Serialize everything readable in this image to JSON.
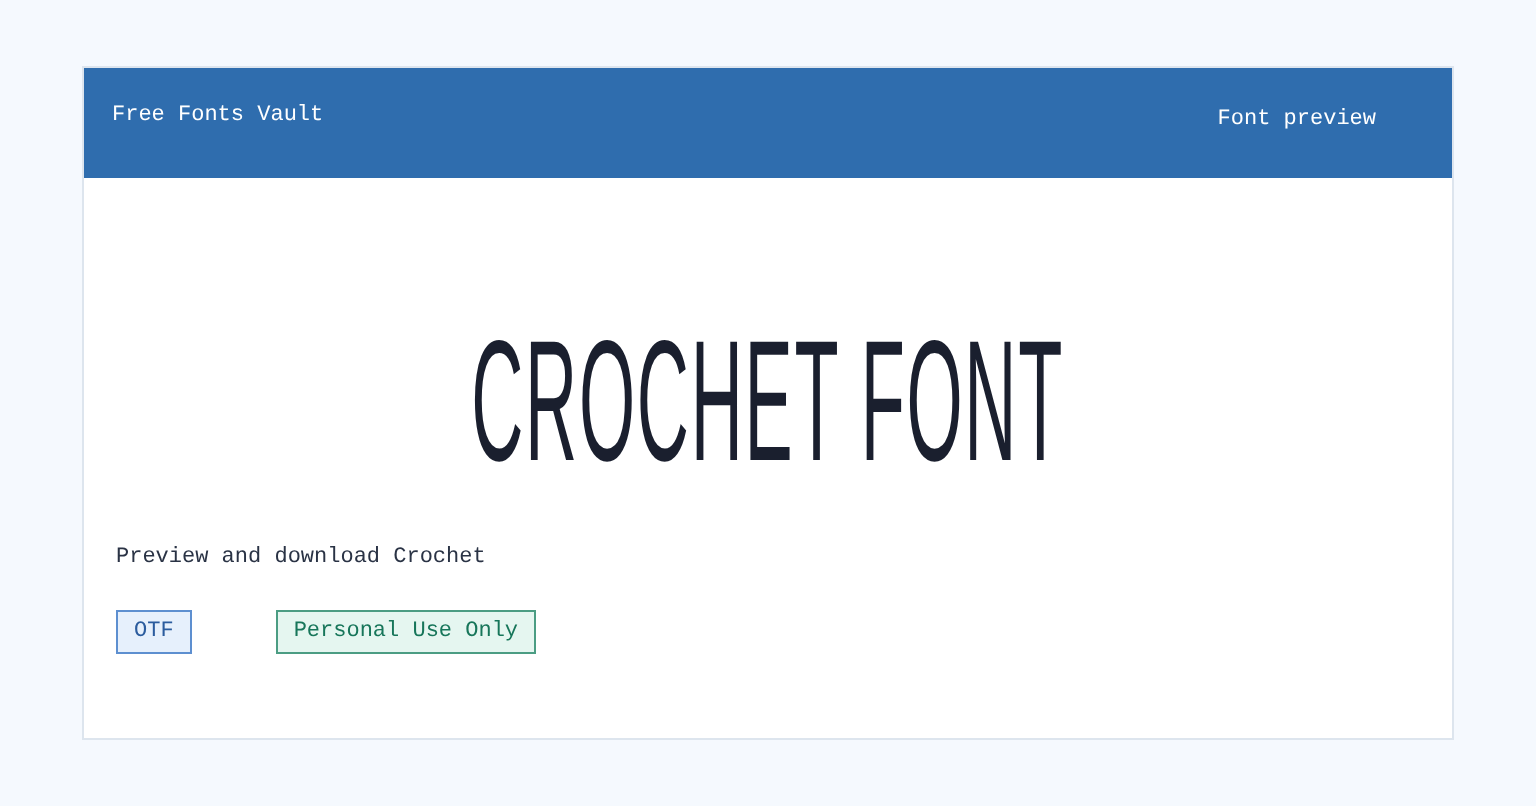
{
  "header": {
    "site_name": "Free Fonts Vault",
    "nav_label": "Font preview"
  },
  "preview": {
    "sample_text": "CROCHET FONT"
  },
  "description": "Preview and download Crochet",
  "tags": [
    {
      "label": "OTF",
      "kind": "format"
    },
    {
      "label": "Personal Use Only",
      "kind": "license"
    }
  ]
}
